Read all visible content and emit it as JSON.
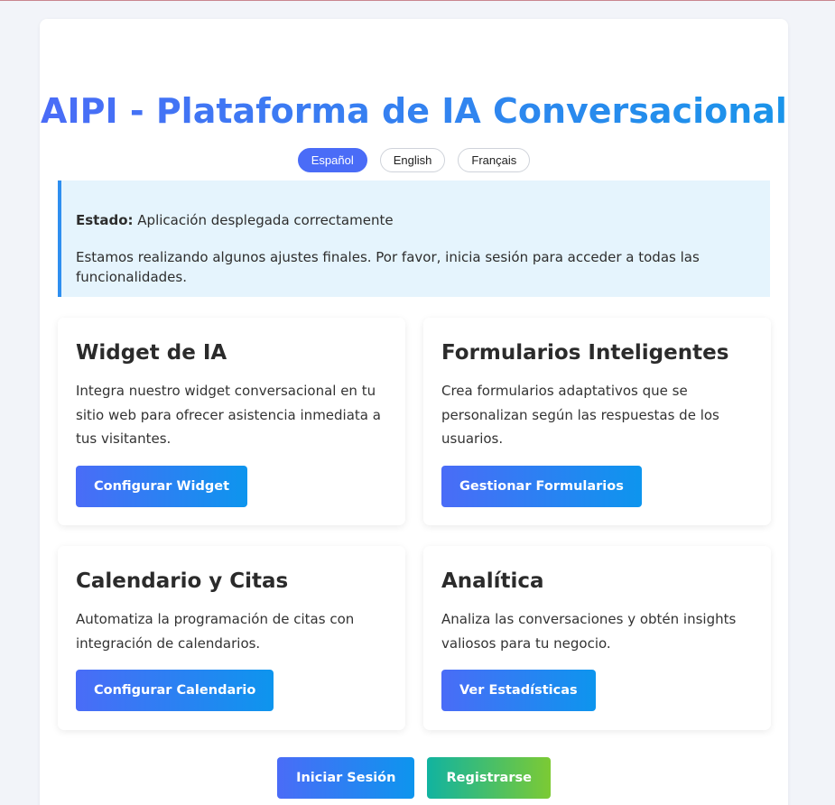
{
  "header": {
    "title": "AIPI - Plataforma de IA Conversacional"
  },
  "languages": [
    {
      "label": "Español",
      "active": true
    },
    {
      "label": "English",
      "active": false
    },
    {
      "label": "Français",
      "active": false
    }
  ],
  "status": {
    "label": "Estado:",
    "text": "Aplicación desplegada correctamente",
    "message": "Estamos realizando algunos ajustes finales. Por favor, inicia sesión para acceder a todas las funcionalidades."
  },
  "cards": [
    {
      "title": "Widget de IA",
      "description": "Integra nuestro widget conversacional en tu sitio web para ofrecer asistencia inmediata a tus visitantes.",
      "button": "Configurar Widget"
    },
    {
      "title": "Formularios Inteligentes",
      "description": "Crea formularios adaptativos que se personalizan según las respuestas de los usuarios.",
      "button": "Gestionar Formularios"
    },
    {
      "title": "Calendario y Citas",
      "description": "Automatiza la programación de citas con integración de calendarios.",
      "button": "Configurar Calendario"
    },
    {
      "title": "Analítica",
      "description": "Analiza las conversaciones y obtén insights valiosos para tu negocio.",
      "button": "Ver Estadísticas"
    }
  ],
  "auth": {
    "login": "Iniciar Sesión",
    "register": "Registrarse"
  },
  "colors": {
    "accent": "#4a6cf7",
    "accent_end": "#0d95ee",
    "register_start": "#11b3a0",
    "register_end": "#7cca34",
    "status_bg": "#e5f4fd",
    "status_border": "#2e8ff0",
    "page_bg": "#f2f4f9"
  }
}
